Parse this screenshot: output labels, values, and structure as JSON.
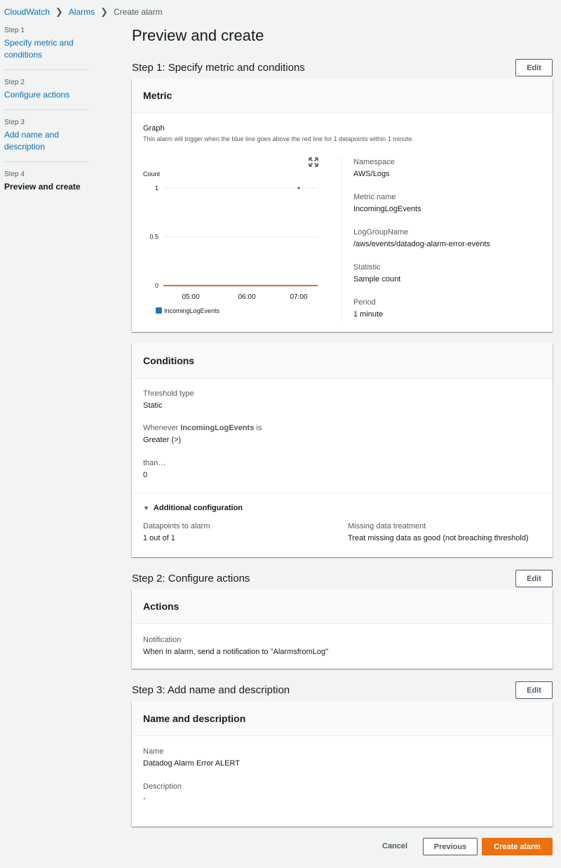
{
  "breadcrumb": {
    "items": [
      "CloudWatch",
      "Alarms"
    ],
    "current": "Create alarm"
  },
  "sidebar": {
    "steps": [
      {
        "num": "Step 1",
        "label": "Specify metric and conditions"
      },
      {
        "num": "Step 2",
        "label": "Configure actions"
      },
      {
        "num": "Step 3",
        "label": "Add name and description"
      },
      {
        "num": "Step 4",
        "label": "Preview and create"
      }
    ]
  },
  "page": {
    "title": "Preview and create"
  },
  "step1": {
    "title": "Step 1: Specify metric and conditions",
    "edit_label": "Edit",
    "metric": {
      "header": "Metric",
      "graph_label": "Graph",
      "graph_desc": "This alarm will trigger when the blue line goes above the red line for 1 datapoints within 1 minute.",
      "details": [
        {
          "label": "Namespace",
          "value": "AWS/Logs"
        },
        {
          "label": "Metric name",
          "value": "IncomingLogEvents"
        },
        {
          "label": "LogGroupName",
          "value": "/aws/events/datadog-alarm-error-events"
        },
        {
          "label": "Statistic",
          "value": "Sample count"
        },
        {
          "label": "Period",
          "value": "1 minute"
        }
      ]
    },
    "conditions": {
      "header": "Conditions",
      "threshold_type_label": "Threshold type",
      "threshold_type_value": "Static",
      "whenever_prefix": "Whenever ",
      "whenever_metric": "IncomingLogEvents",
      "whenever_suffix": " is",
      "operator_value": "Greater (>)",
      "than_label": "than…",
      "than_value": "0",
      "additional_config": "Additional configuration",
      "datapoints_label": "Datapoints to alarm",
      "datapoints_value": "1 out of 1",
      "missing_label": "Missing data treatment",
      "missing_value": "Treat missing data as good (not breaching threshold)"
    }
  },
  "step2": {
    "title": "Step 2: Configure actions",
    "edit_label": "Edit",
    "actions": {
      "header": "Actions",
      "notification_label": "Notification",
      "notification_value": "When In alarm, send a notification to \"AlarmsfromLog\""
    }
  },
  "step3": {
    "title": "Step 3: Add name and description",
    "edit_label": "Edit",
    "name_desc": {
      "header": "Name and description",
      "name_label": "Name",
      "name_value": "Datadog Alarm Error ALERT",
      "desc_label": "Description",
      "desc_value": "-"
    }
  },
  "footer": {
    "cancel": "Cancel",
    "previous": "Previous",
    "create": "Create alarm"
  },
  "colors": {
    "link": "#0073bb",
    "primary": "#ec7211",
    "series": "#1f77b4",
    "threshold": "#d13212"
  },
  "chart_data": {
    "type": "line",
    "ylabel": "Count",
    "yticks": [
      "1",
      "0.5",
      "0"
    ],
    "ylim": [
      0,
      1
    ],
    "xticks": [
      "05:00",
      "06:00",
      "07:00"
    ],
    "series": [
      {
        "name": "IncomingLogEvents",
        "points": [
          {
            "x": "07:00",
            "y": 1
          }
        ]
      }
    ],
    "threshold": 0
  }
}
